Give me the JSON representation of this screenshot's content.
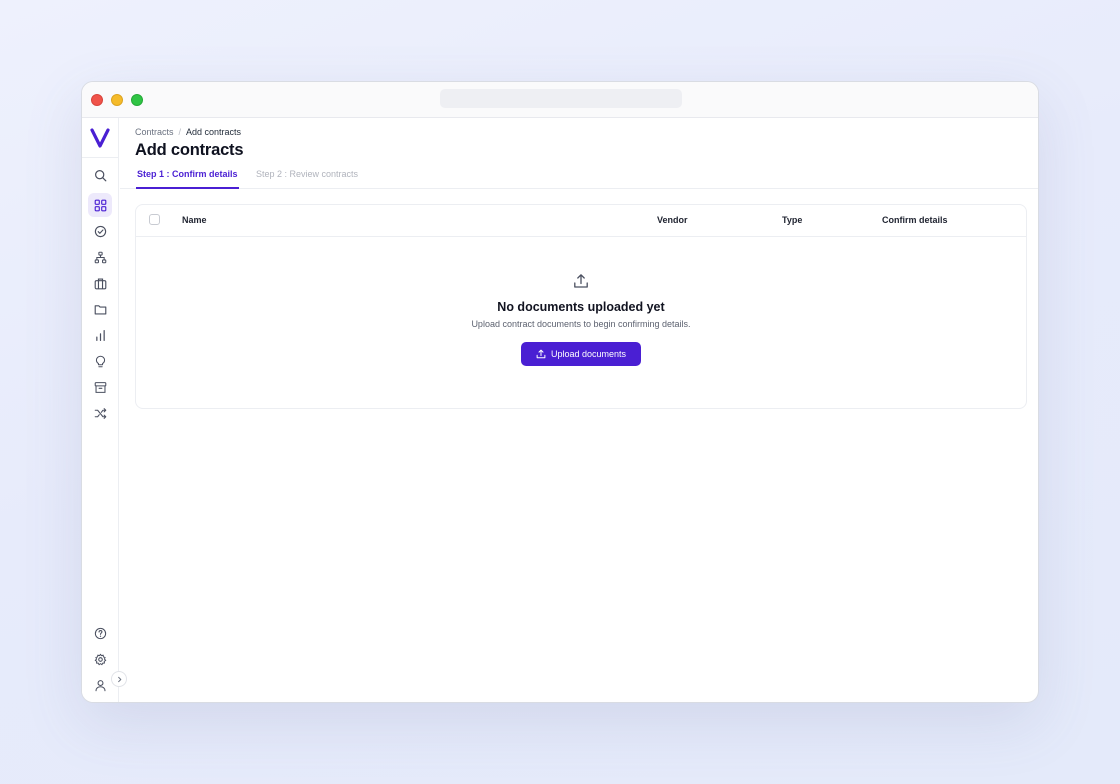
{
  "breadcrumb": {
    "parent": "Contracts",
    "separator": "/",
    "current": "Add contracts"
  },
  "page": {
    "title": "Add contracts"
  },
  "tabs": [
    {
      "label": "Step 1 : Confirm details",
      "active": true
    },
    {
      "label": "Step 2 : Review contracts",
      "active": false
    }
  ],
  "table": {
    "columns": [
      "Name",
      "Vendor",
      "Type",
      "Confirm details"
    ]
  },
  "empty_state": {
    "icon": "upload-icon",
    "title": "No documents uploaded yet",
    "subtitle": "Upload contract documents to begin confirming details.",
    "button_label": "Upload documents"
  },
  "sidebar": {
    "logo": "V",
    "top_icons": [
      "search-icon",
      "grid-icon",
      "check-circle-icon",
      "hierarchy-icon",
      "briefcase-icon",
      "folder-icon",
      "bar-chart-icon",
      "lightbulb-icon",
      "archive-icon",
      "shuffle-icon"
    ],
    "bottom_icons": [
      "help-icon",
      "gear-icon",
      "user-icon"
    ],
    "collapse_icon": "chevron-right-icon"
  },
  "colors": {
    "accent": "#4a1fd3",
    "active_nav_bg": "#ede9fb"
  }
}
